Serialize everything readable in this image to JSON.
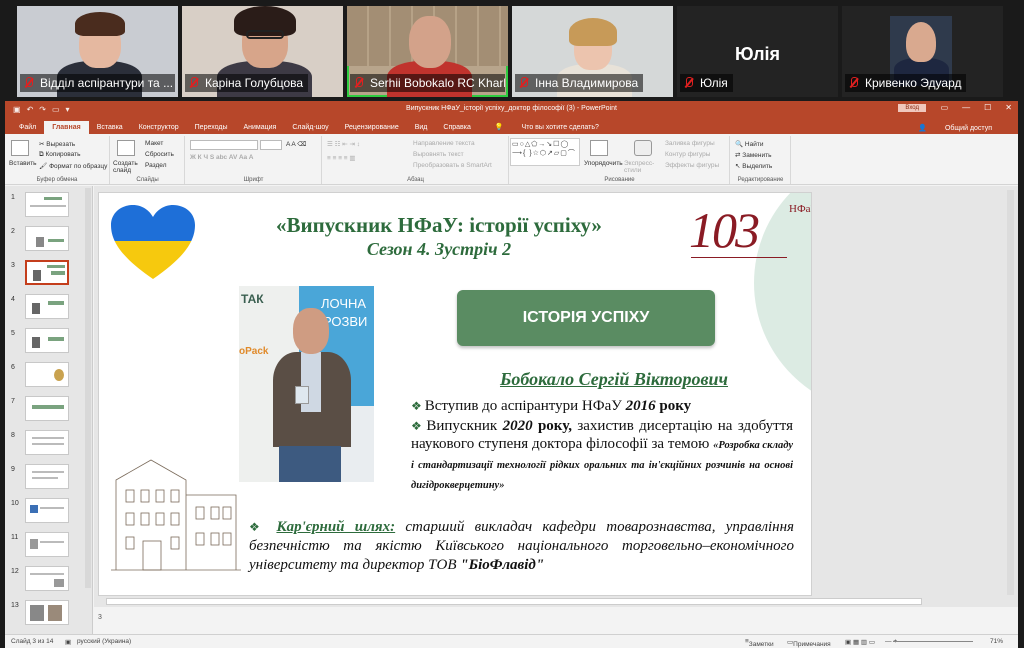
{
  "participants": [
    {
      "name": "Відділ аспірантури та ...",
      "muted": true
    },
    {
      "name": "Каріна Голубцова",
      "muted": true
    },
    {
      "name": "Serhii Bobokalo RC Kharki...",
      "muted": true,
      "active": true
    },
    {
      "name": "Інна Владимирова",
      "muted": true
    },
    {
      "name": "Юлія",
      "muted": true,
      "display": "Юлія"
    },
    {
      "name": "Кривенко Эдуард",
      "muted": true
    }
  ],
  "window": {
    "title": "Випускник НФаУ_історії успіху_доктор філософії (3)  -  PowerPoint",
    "login": "Вход"
  },
  "tabs": [
    "Файл",
    "Главная",
    "Вставка",
    "Конструктор",
    "Переходы",
    "Анимация",
    "Слайд-шоу",
    "Рецензирование",
    "Вид",
    "Справка"
  ],
  "tell_me": "Что вы хотите сделать?",
  "share": "Общий доступ",
  "ribbon": {
    "clipboard": {
      "paste": "Вставить",
      "cut": "Вырезать",
      "copy": "Копировать",
      "format": "Формат по образцу",
      "label": "Буфер обмена"
    },
    "slides": {
      "new": "Создать слайд",
      "layout": "Макет",
      "reset": "Сбросить",
      "section": "Раздел",
      "label": "Слайды"
    },
    "font": {
      "label": "Шрифт"
    },
    "paragraph": {
      "direction": "Направление текста",
      "align": "Выровнять текст",
      "smartart": "Преобразовать в SmartArt",
      "label": "Абзац"
    },
    "drawing": {
      "arrange": "Упорядочить",
      "styles": "Экспресс-стили",
      "fill": "Заливка фигуры",
      "outline": "Контур фигуры",
      "effects": "Эффекты фигуры",
      "label": "Рисование"
    },
    "editing": {
      "find": "Найти",
      "replace": "Заменить",
      "select": "Выделить",
      "label": "Редактирование"
    }
  },
  "thumbnails": [
    "1",
    "2",
    "3",
    "4",
    "5",
    "6",
    "7",
    "8",
    "9",
    "10",
    "11",
    "12",
    "13"
  ],
  "selected_thumbnail": "3",
  "slide": {
    "title": "«Випускник НФаУ: історії успіху»",
    "subtitle": "Сезон 4. Зустріч 2",
    "logo_number": "103",
    "logo_letters": "НФаУ",
    "button": "ІСТОРІЯ УСПІХУ",
    "person_name": "Бобокало Сергій Вікторович",
    "bullet1_text": "Вступив до аспірантури НФаУ ",
    "bullet1_year": "2016",
    "bullet1_end": " року",
    "bullet2_a": "Випускник ",
    "bullet2_year": "2020",
    "bullet2_b": " року,",
    "bullet2_c": " захистив дисертацію на здобуття наукового ступеня доктора філософії за темою ",
    "bullet2_topic": "«Розробка складу і стандартизації технології рідких оральних та ін'єкційних розчинів на основі дигідрокверцетину»",
    "career_label": "Кар'єрний шлях:",
    "career_text": " старший викладач кафедри товарознавства, управління безпечністю та якістю Київського національного торговельно–економічного університету та директор ТОВ ",
    "career_company": "\"БіоФлавід\"",
    "photo_sign1": "ТАК",
    "photo_sign2": "ЛОЧНА",
    "photo_sign3": "РОЗВИ",
    "photo_sign4": "oPack"
  },
  "notes_text": "3",
  "status": {
    "slide": "Слайд 3 из 14",
    "language": "русский (Украина)",
    "notes": "Заметки",
    "comments": "Примечания",
    "zoom": "71%"
  }
}
